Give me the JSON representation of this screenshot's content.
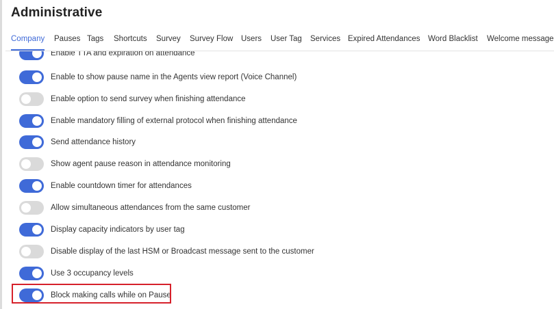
{
  "header": {
    "title": "Administrative"
  },
  "tabs": [
    {
      "label": "Company",
      "active": true
    },
    {
      "label": "Pauses",
      "active": false
    },
    {
      "label": "Tags",
      "active": false
    },
    {
      "label": "Shortcuts",
      "active": false
    },
    {
      "label": "Survey",
      "active": false
    },
    {
      "label": "Survey Flow",
      "active": false
    },
    {
      "label": "Users",
      "active": false
    },
    {
      "label": "User Tag",
      "active": false
    },
    {
      "label": "Services",
      "active": false
    },
    {
      "label": "Expired Attendances",
      "active": false
    },
    {
      "label": "Word Blacklist",
      "active": false
    },
    {
      "label": "Welcome message",
      "active": false
    }
  ],
  "options": [
    {
      "label": "Enable TTA and expiration on attendance",
      "enabled": true
    },
    {
      "label": "Enable to show pause name in the Agents view report (Voice Channel)",
      "enabled": true
    },
    {
      "label": "Enable option to send survey when finishing attendance",
      "enabled": false
    },
    {
      "label": "Enable mandatory filling of external protocol when finishing attendance",
      "enabled": true
    },
    {
      "label": "Send attendance history",
      "enabled": true
    },
    {
      "label": "Show agent pause reason in attendance monitoring",
      "enabled": false
    },
    {
      "label": "Enable countdown timer for attendances",
      "enabled": true
    },
    {
      "label": "Allow simultaneous attendances from the same customer",
      "enabled": false
    },
    {
      "label": "Display capacity indicators by user tag",
      "enabled": true
    },
    {
      "label": "Disable display of the last HSM or Broadcast message sent to the customer",
      "enabled": false
    },
    {
      "label": "Use 3 occupancy levels",
      "enabled": true
    },
    {
      "label": "Block making calls while on Pause",
      "enabled": true,
      "highlighted": true
    }
  ],
  "colors": {
    "accent": "#3f6ad8",
    "toggle_off": "#dadada",
    "highlight": "#d6202a"
  }
}
